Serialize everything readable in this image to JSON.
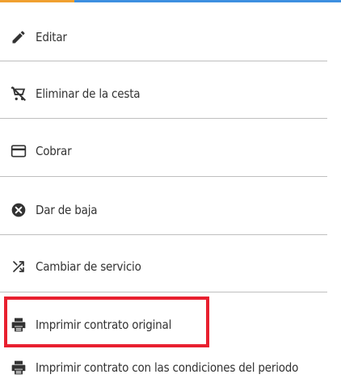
{
  "accent_colors": {
    "highlight": "#e8202f",
    "divider": "#bfbfbf",
    "text": "#333333"
  },
  "menu": {
    "items": [
      {
        "label": "Editar",
        "icon": "pencil-icon"
      },
      {
        "label": "Eliminar de la cesta",
        "icon": "cart-remove-icon"
      },
      {
        "label": "Cobrar",
        "icon": "credit-card-icon"
      },
      {
        "label": "Dar de baja",
        "icon": "cancel-circle-icon"
      },
      {
        "label": "Cambiar de servicio",
        "icon": "shuffle-icon"
      },
      {
        "label": "Imprimir contrato original",
        "icon": "printer-icon"
      },
      {
        "label": "Imprimir contrato con las condiciones del periodo",
        "icon": "printer-icon"
      }
    ]
  }
}
